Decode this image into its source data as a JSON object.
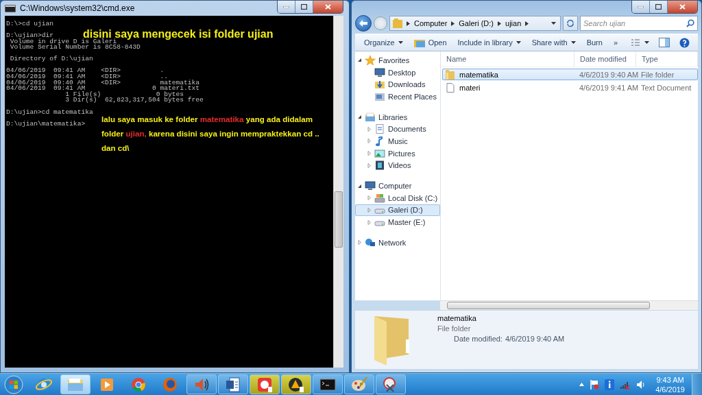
{
  "cmd_window": {
    "title": "C:\\Windows\\system32\\cmd.exe",
    "blocks": [
      [
        "D:\\>cd ujian"
      ],
      [
        "D:\\ujian>dir",
        " Volume in drive D is Galeri",
        " Volume Serial Number is 8C58-843D"
      ],
      [
        " Directory of D:\\ujian"
      ],
      [
        "04/06/2019  09:41 AM    <DIR>          .",
        "04/06/2019  09:41 AM    <DIR>          ..",
        "04/06/2019  09:40 AM    <DIR>          matematika",
        "04/06/2019  09:41 AM                 0 materi.txt",
        "               1 File(s)              0 bytes",
        "               3 Dir(s)  62,823,317,504 bytes free"
      ],
      [
        "D:\\ujian>cd matematika"
      ],
      [
        "D:\\ujian\\matematika>"
      ]
    ],
    "notes": [
      {
        "kind": "heading",
        "segments": [
          {
            "text": "disini saya mengecek isi folder ujian",
            "highlight": false
          }
        ]
      },
      {
        "kind": "caption",
        "segments": [
          {
            "text": "lalu saya masuk ke folder ",
            "highlight": false
          },
          {
            "text": "matematika",
            "highlight": true
          },
          {
            "text": " yang ada didalam folder ",
            "highlight": false
          },
          {
            "text": "ujian,",
            "highlight": true
          },
          {
            "text": " karena disini saya ingin mempraktekkan cd .. dan cd\\",
            "highlight": false
          }
        ]
      }
    ]
  },
  "explorer": {
    "breadcrumb": [
      "Computer",
      "Galeri (D:)",
      "ujian"
    ],
    "search": {
      "placeholder": "Search ujian"
    },
    "toolbar": [
      {
        "label": "Organize",
        "dropdown": true,
        "icon": false
      },
      {
        "label": "Open",
        "dropdown": false,
        "icon": true
      },
      {
        "label": "Include in library",
        "dropdown": true,
        "icon": false
      },
      {
        "label": "Share with",
        "dropdown": true,
        "icon": false
      },
      {
        "label": "Burn",
        "dropdown": false,
        "icon": false
      },
      {
        "label": "»",
        "dropdown": false,
        "icon": false
      }
    ],
    "nav": [
      {
        "label": "Favorites",
        "kind": "star",
        "expanded": true,
        "selected": false,
        "children": [
          {
            "label": "Desktop",
            "kind": "desktop",
            "selected": false
          },
          {
            "label": "Downloads",
            "kind": "downloads",
            "selected": false
          },
          {
            "label": "Recent Places",
            "kind": "recent",
            "selected": false
          }
        ]
      },
      {
        "label": "Libraries",
        "kind": "library",
        "expanded": true,
        "selected": false,
        "children": [
          {
            "label": "Documents",
            "kind": "document",
            "selected": false,
            "expanded": false
          },
          {
            "label": "Music",
            "kind": "music",
            "selected": false,
            "expanded": false
          },
          {
            "label": "Pictures",
            "kind": "picture",
            "selected": false,
            "expanded": false
          },
          {
            "label": "Videos",
            "kind": "video",
            "selected": false,
            "expanded": false
          }
        ]
      },
      {
        "label": "Computer",
        "kind": "computer",
        "expanded": true,
        "selected": false,
        "children": [
          {
            "label": "Local Disk (C:)",
            "kind": "system-drive",
            "selected": false,
            "expanded": false
          },
          {
            "label": "Galeri (D:)",
            "kind": "drive",
            "selected": true,
            "expanded": false
          },
          {
            "label": "Master (E:)",
            "kind": "drive",
            "selected": false,
            "expanded": false
          }
        ]
      },
      {
        "label": "Network",
        "kind": "network",
        "expanded": false,
        "selected": false
      }
    ],
    "columns": [
      "Name",
      "Date modified",
      "Type"
    ],
    "files": [
      {
        "name": "matematika",
        "date": "4/6/2019 9:40 AM",
        "type": "File folder",
        "kind": "folder",
        "selected": true
      },
      {
        "name": "materi",
        "date": "4/6/2019 9:41 AM",
        "type": "Text Document",
        "kind": "text",
        "selected": false
      }
    ],
    "details": {
      "name": "matematika",
      "type": "File folder",
      "date_label": "Date modified:",
      "date": "4/6/2019 9:40 AM"
    }
  },
  "taskbar": {
    "apps": [
      {
        "kind": "ie",
        "running": false,
        "attention": false,
        "selected": false
      },
      {
        "kind": "explorer",
        "running": true,
        "attention": false,
        "selected": true
      },
      {
        "kind": "media",
        "running": false,
        "attention": false,
        "selected": false
      },
      {
        "kind": "chrome",
        "running": false,
        "attention": false,
        "selected": false
      },
      {
        "kind": "firefox",
        "running": false,
        "attention": false,
        "selected": false
      },
      {
        "kind": "speaker",
        "running": true,
        "attention": false,
        "selected": false
      },
      {
        "kind": "word",
        "running": true,
        "attention": false,
        "selected": false
      },
      {
        "kind": "recorder",
        "running": true,
        "attention": true,
        "selected": false
      },
      {
        "kind": "player",
        "running": true,
        "attention": true,
        "selected": false
      },
      {
        "kind": "console",
        "running": true,
        "attention": false,
        "selected": false
      },
      {
        "kind": "paint",
        "running": true,
        "attention": false,
        "selected": false
      },
      {
        "kind": "snip",
        "running": true,
        "attention": false,
        "selected": false
      }
    ],
    "time": "9:43 AM",
    "date": "4/6/2019"
  }
}
